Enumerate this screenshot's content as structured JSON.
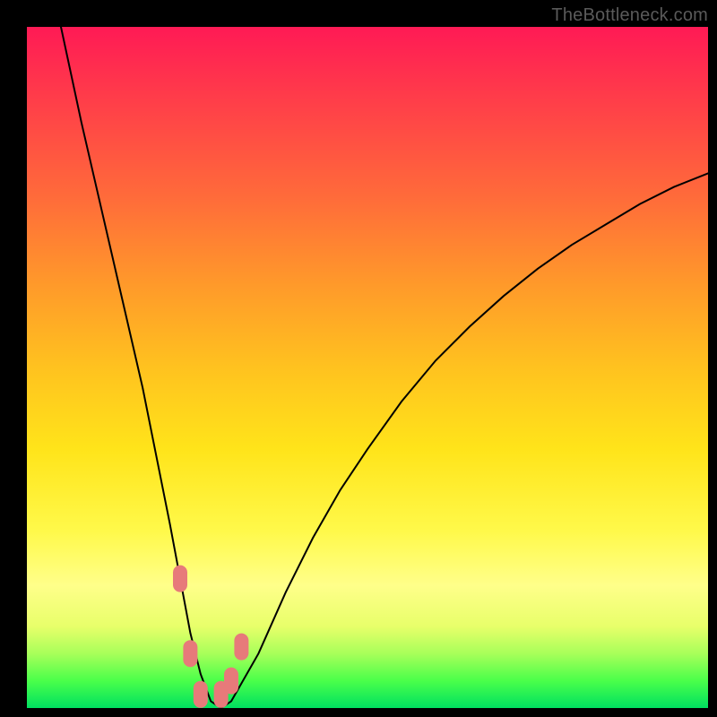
{
  "watermark": "TheBottleneck.com",
  "chart_data": {
    "type": "line",
    "title": "",
    "xlabel": "",
    "ylabel": "",
    "xlim": [
      0,
      100
    ],
    "ylim": [
      0,
      100
    ],
    "series": [
      {
        "name": "curve",
        "x": [
          5,
          8,
          11,
          14,
          17,
          19,
          21,
          22.5,
          24,
          25.5,
          27,
          28.5,
          30,
          34,
          38,
          42,
          46,
          50,
          55,
          60,
          65,
          70,
          75,
          80,
          85,
          90,
          95,
          100
        ],
        "y": [
          100,
          86,
          73,
          60,
          47,
          37,
          27,
          19,
          11,
          5,
          1,
          0,
          1,
          8,
          17,
          25,
          32,
          38,
          45,
          51,
          56,
          60.5,
          64.5,
          68,
          71,
          74,
          76.5,
          78.5
        ]
      }
    ],
    "markers": {
      "name": "highlight-points",
      "color": "#e77a7a",
      "points": [
        {
          "x": 22.5,
          "y": 19
        },
        {
          "x": 24,
          "y": 8
        },
        {
          "x": 25.5,
          "y": 2
        },
        {
          "x": 28.5,
          "y": 2
        },
        {
          "x": 30,
          "y": 4
        },
        {
          "x": 31.5,
          "y": 9
        }
      ]
    }
  }
}
